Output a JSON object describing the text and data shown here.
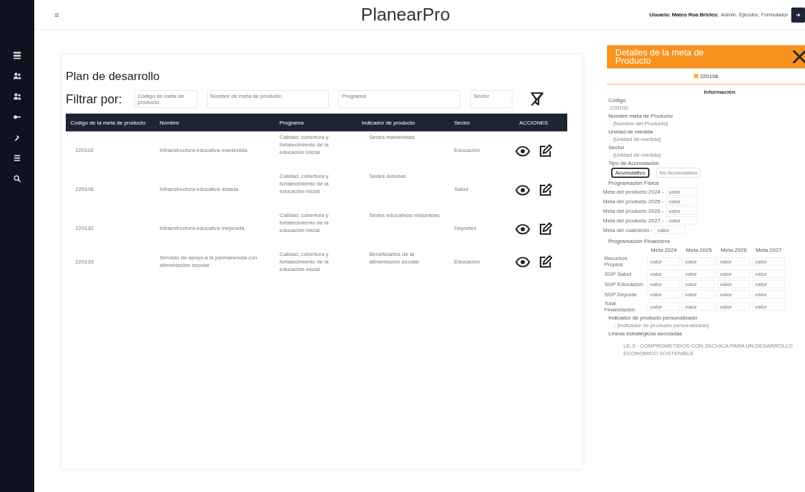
{
  "app": {
    "title": "PlanearPro",
    "user_label": "Usuario: Mateo Roa Bricles:",
    "roles": [
      "Admin,",
      "Ejecutor,",
      "Formulador"
    ]
  },
  "sidebar": {
    "items": [
      {
        "kind": "grid"
      },
      {
        "kind": "users"
      },
      {
        "kind": "users"
      },
      {
        "kind": "key"
      },
      {
        "kind": "pin"
      },
      {
        "kind": "list"
      },
      {
        "kind": "search"
      }
    ]
  },
  "page": {
    "title": "Plan de desarrollo",
    "filter_label": "Filtrar por:",
    "filters": [
      {
        "placeholder": "Codigo de meta de producto"
      },
      {
        "placeholder": "Nombre de meta de producto"
      },
      {
        "placeholder": "Programa"
      },
      {
        "placeholder": "Sector"
      }
    ]
  },
  "table": {
    "columns": [
      "Codigo de la meta de producto",
      "Nombre",
      "Programa",
      "Indicador de producto",
      "Sector",
      "ACCIONES"
    ],
    "rows": [
      {
        "code": "220102",
        "name": "Infraestructura educativa mantenida",
        "program": "Calidad, cobertura y fortalecimiento de la educación inicial",
        "indicator": "Sedes mantenidas",
        "sector": "Educación"
      },
      {
        "code": "220106",
        "name": "Infraestructura educativa dotada",
        "program": "Calidad, cobertura y fortalecimiento de la educación inicial",
        "indicator": "Sedes dotadas",
        "sector": "Salud"
      },
      {
        "code": "220132",
        "name": "Infraestructura educativa mejorada",
        "program": "Calidad, cobertura y fortalecimiento de la educación inicial",
        "indicator": "Sedes educativas mejoradas",
        "sector": "Deportes"
      },
      {
        "code": "220133",
        "name": "Servicio de apoyo a la permanencia con alimentación escolar",
        "program": "Calidad, cobertura y fortalecimiento de la educación inicial",
        "indicator": "Beneficiarios de la alimentación escolar",
        "sector": "Educación"
      }
    ]
  },
  "details": {
    "title": "Detalles de la meta de Producto",
    "badge": "220106",
    "section": "Información",
    "fields": [
      {
        "label": "Codigo",
        "value": "220102"
      },
      {
        "label": "Nombre meta de Producto",
        "value": "- [Nombre del Producto]"
      },
      {
        "label": "Unidad de medida",
        "value": "- [Unidad de medida]"
      },
      {
        "label": "Sector",
        "value": "- [Unidad de medida]"
      }
    ],
    "accumulation_label": "Tipo de Acumulación",
    "accumulation": [
      {
        "label": "Acumulativo",
        "selected": true
      },
      {
        "label": "No Acumulativo",
        "selected": false
      }
    ],
    "physical_label": "Programación Física",
    "physical": [
      {
        "label": "Meta del producto 2024 -",
        "placeholder": "valor"
      },
      {
        "label": "Meta del producto 2025 -",
        "placeholder": "valor"
      },
      {
        "label": "Meta del producto 2026 -",
        "placeholder": "valor"
      },
      {
        "label": "Meta del producto 2027 -",
        "placeholder": "valor"
      },
      {
        "label": "Meta del cuatrienio -",
        "placeholder": "valor"
      }
    ],
    "financial_label": "Programación Financiera",
    "financial_columns": [
      "Meta 2024",
      "Meta 2025",
      "Meta 2026",
      "Meta 2027"
    ],
    "financial_rows": [
      {
        "label": "Recursos Propios",
        "cells": [
          {
            "placeholder": "valor"
          },
          {
            "placeholder": "valor"
          },
          {
            "placeholder": "valor"
          },
          {
            "placeholder": "valor"
          }
        ]
      },
      {
        "label": "SGP Salud",
        "cells": [
          {
            "placeholder": "valor"
          },
          {
            "placeholder": "valor"
          },
          {
            "placeholder": "valor"
          },
          {
            "placeholder": "valor"
          }
        ]
      },
      {
        "label": "SGP Educación",
        "cells": [
          {
            "placeholder": "valor"
          },
          {
            "placeholder": "valor"
          },
          {
            "placeholder": "valor"
          },
          {
            "placeholder": "valor"
          }
        ]
      },
      {
        "label": "SGP Deporte",
        "cells": [
          {
            "placeholder": "valor"
          },
          {
            "placeholder": "valor"
          },
          {
            "placeholder": "valor"
          },
          {
            "placeholder": "valor"
          }
        ]
      },
      {
        "label": "Total Financiación",
        "cells": [
          {
            "placeholder": "valor"
          },
          {
            "placeholder": "valor"
          },
          {
            "placeholder": "valor"
          },
          {
            "placeholder": "valor"
          }
        ]
      }
    ],
    "custom_indicator_label": "Indicador de producto personalizado",
    "custom_indicator": "- [Indicador de producto personalizado]",
    "lines_label": "Líneas estratégicas asociadas",
    "lines": [
      "LE-3 - COMPROMETIDOS CON ZACHICA PARA UN DESARROLLO ECONOMICO SOSTENIBLE"
    ]
  }
}
